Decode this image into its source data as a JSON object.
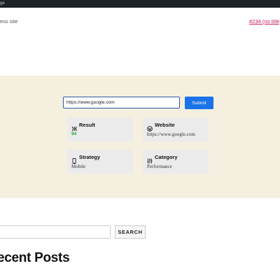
{
  "admin_bar": {
    "text": "ge"
  },
  "header": {
    "site_description": "ess site",
    "post_link": "#234 (no title)"
  },
  "form": {
    "url_value": "https://www.google.com",
    "submit_label": "Submit"
  },
  "cards": [
    {
      "title": "Result",
      "value": "94",
      "icon": "speedometer-icon",
      "status_color": "#2e9e3e"
    },
    {
      "title": "Website",
      "value": "https://www.google.com",
      "icon": "wordpress-icon"
    },
    {
      "title": "Strategy",
      "value": "Mobile",
      "icon": "mobile-icon"
    },
    {
      "title": "Category",
      "value": "Performance",
      "icon": "sliders-icon"
    }
  ],
  "search": {
    "button_label": "SEARCH"
  },
  "sidebar": {
    "recent_posts_heading": "ecent Posts"
  },
  "colors": {
    "accent": "#1a73e8",
    "panel_bg": "#f5efe0",
    "link": "#c2185b"
  }
}
